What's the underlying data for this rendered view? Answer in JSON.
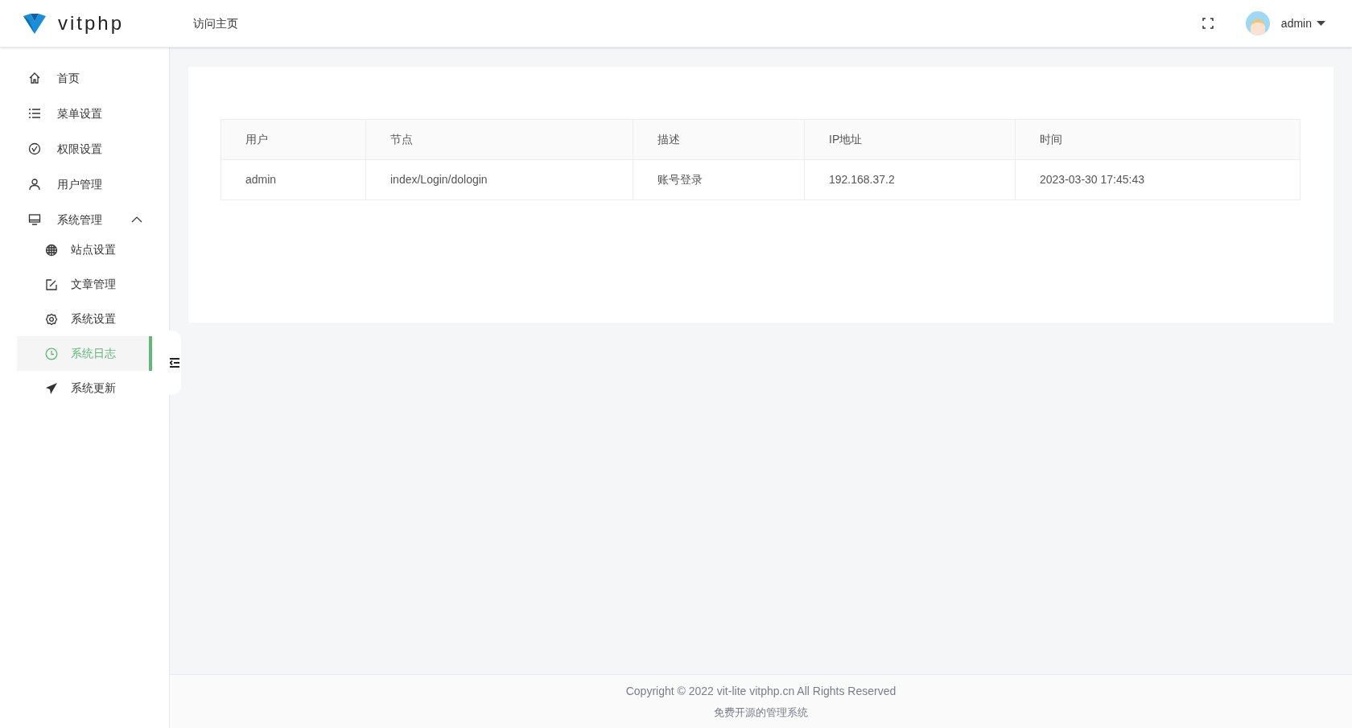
{
  "header": {
    "logo_text": "vitphp",
    "nav_link": "访问主页",
    "user": "admin"
  },
  "sidebar": {
    "items": [
      {
        "label": "首页",
        "selected": false
      },
      {
        "label": "菜单设置",
        "selected": false
      },
      {
        "label": "权限设置",
        "selected": false
      },
      {
        "label": "用户管理",
        "selected": false
      },
      {
        "label": "系统管理",
        "selected": false,
        "expanded": true,
        "children": [
          {
            "label": "站点设置",
            "selected": false
          },
          {
            "label": "文章管理",
            "selected": false
          },
          {
            "label": "系统设置",
            "selected": false
          },
          {
            "label": "系统日志",
            "selected": true
          },
          {
            "label": "系统更新",
            "selected": false
          }
        ]
      }
    ]
  },
  "table": {
    "columns": [
      "用户",
      "节点",
      "描述",
      "IP地址",
      "时间"
    ],
    "rows": [
      [
        "admin",
        "index/Login/dologin",
        "账号登录",
        "192.168.37.2",
        "2023-03-30 17:45:43"
      ]
    ]
  },
  "footer": {
    "copyright": "Copyright © 2022 vit-lite vitphp.cn All Rights Reserved",
    "tagline": "免费开源的管理系统"
  }
}
